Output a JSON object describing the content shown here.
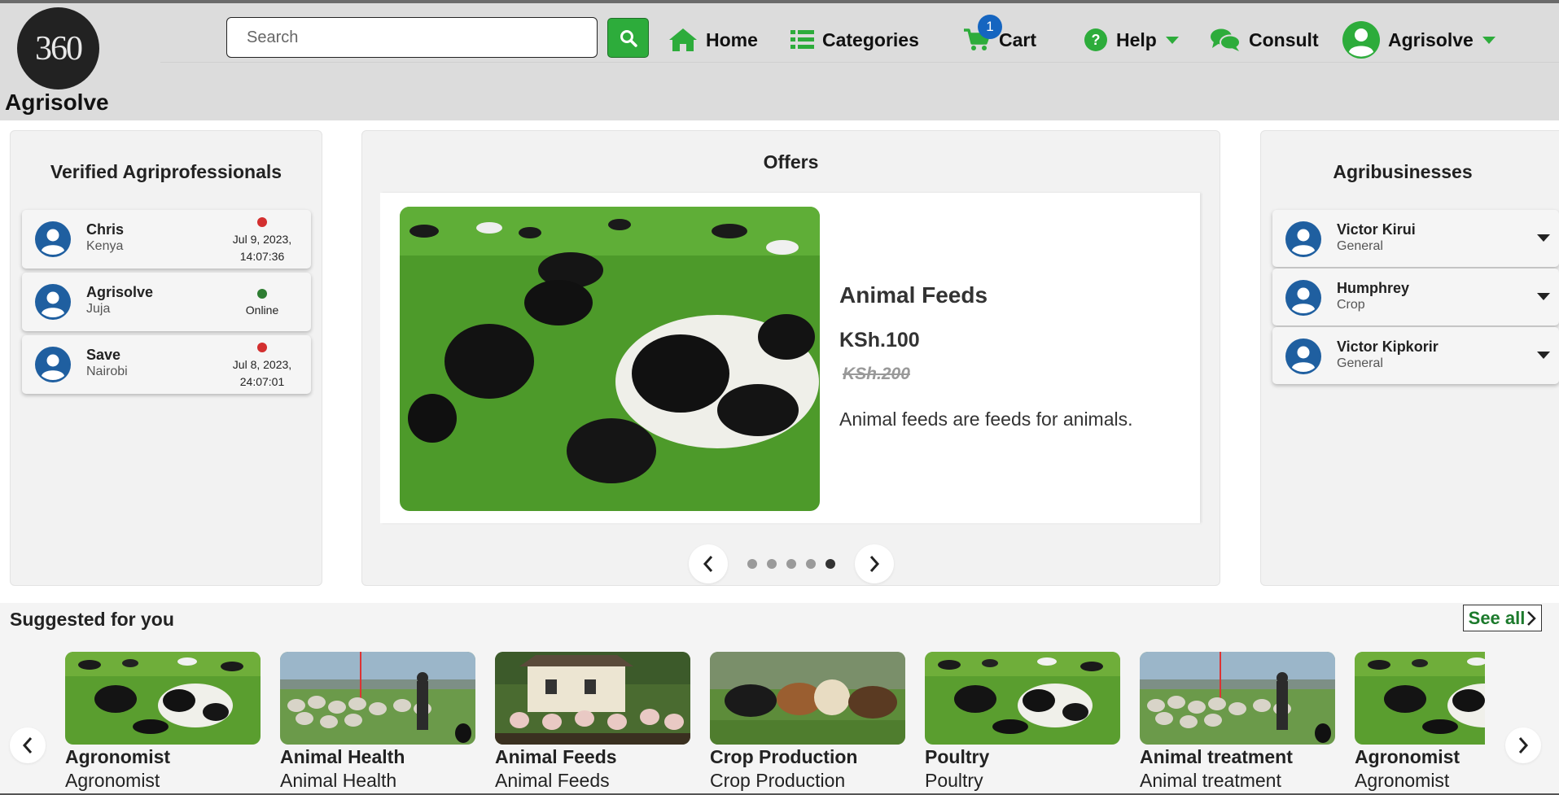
{
  "brand": {
    "logo_text": "360",
    "name": "Agrisolve"
  },
  "search": {
    "placeholder": "Search"
  },
  "nav": {
    "home": "Home",
    "categories": "Categories",
    "cart": "Cart",
    "cart_count": "1",
    "help": "Help",
    "consult": "Consult",
    "user": "Agrisolve"
  },
  "professionals": {
    "title": "Verified Agriprofessionals",
    "items": [
      {
        "name": "Chris",
        "location": "Kenya",
        "status_line1": "Jul 9, 2023,",
        "status_line2": "14:07:36",
        "online": false
      },
      {
        "name": "Agrisolve",
        "location": "Juja",
        "status_line1": "Online",
        "status_line2": "",
        "online": true
      },
      {
        "name": "Save",
        "location": "Nairobi",
        "status_line1": "Jul 8, 2023,",
        "status_line2": "24:07:01",
        "online": false
      }
    ]
  },
  "offers": {
    "title": "Offers",
    "current": {
      "title": "Animal Feeds",
      "price": "KSh.100",
      "old_price": "KSh.200",
      "description": "Animal feeds are feeds for animals."
    },
    "slide_count": 5,
    "active_index": 4
  },
  "agribusinesses": {
    "title": "Agribusinesses",
    "items": [
      {
        "name": "Victor Kirui",
        "category": "General"
      },
      {
        "name": "Humphrey",
        "category": "Crop"
      },
      {
        "name": "Victor Kipkorir",
        "category": "General"
      }
    ]
  },
  "suggested": {
    "title": "Suggested for you",
    "see_all": "See all",
    "items": [
      {
        "name": "Agronomist",
        "category": "Agronomist",
        "image": "cows"
      },
      {
        "name": "Animal Health",
        "category": "Animal Health",
        "image": "sheep-herder"
      },
      {
        "name": "Animal Feeds",
        "category": "Animal Feeds",
        "image": "sheep-house"
      },
      {
        "name": "Crop Production",
        "category": "Crop Production",
        "image": "cattle"
      },
      {
        "name": "Poultry",
        "category": "Poultry",
        "image": "cows"
      },
      {
        "name": "Animal treatment",
        "category": "Animal treatment",
        "image": "sheep-herder"
      },
      {
        "name": "Agronomist",
        "category": "Agronomist",
        "image": "cows"
      }
    ]
  },
  "colors": {
    "accent_green": "#2dac3b",
    "badge_blue": "#1565c0",
    "offline_red": "#d32f2f",
    "online_green": "#2e7d32",
    "avatar_blue": "#1f5fa0"
  }
}
